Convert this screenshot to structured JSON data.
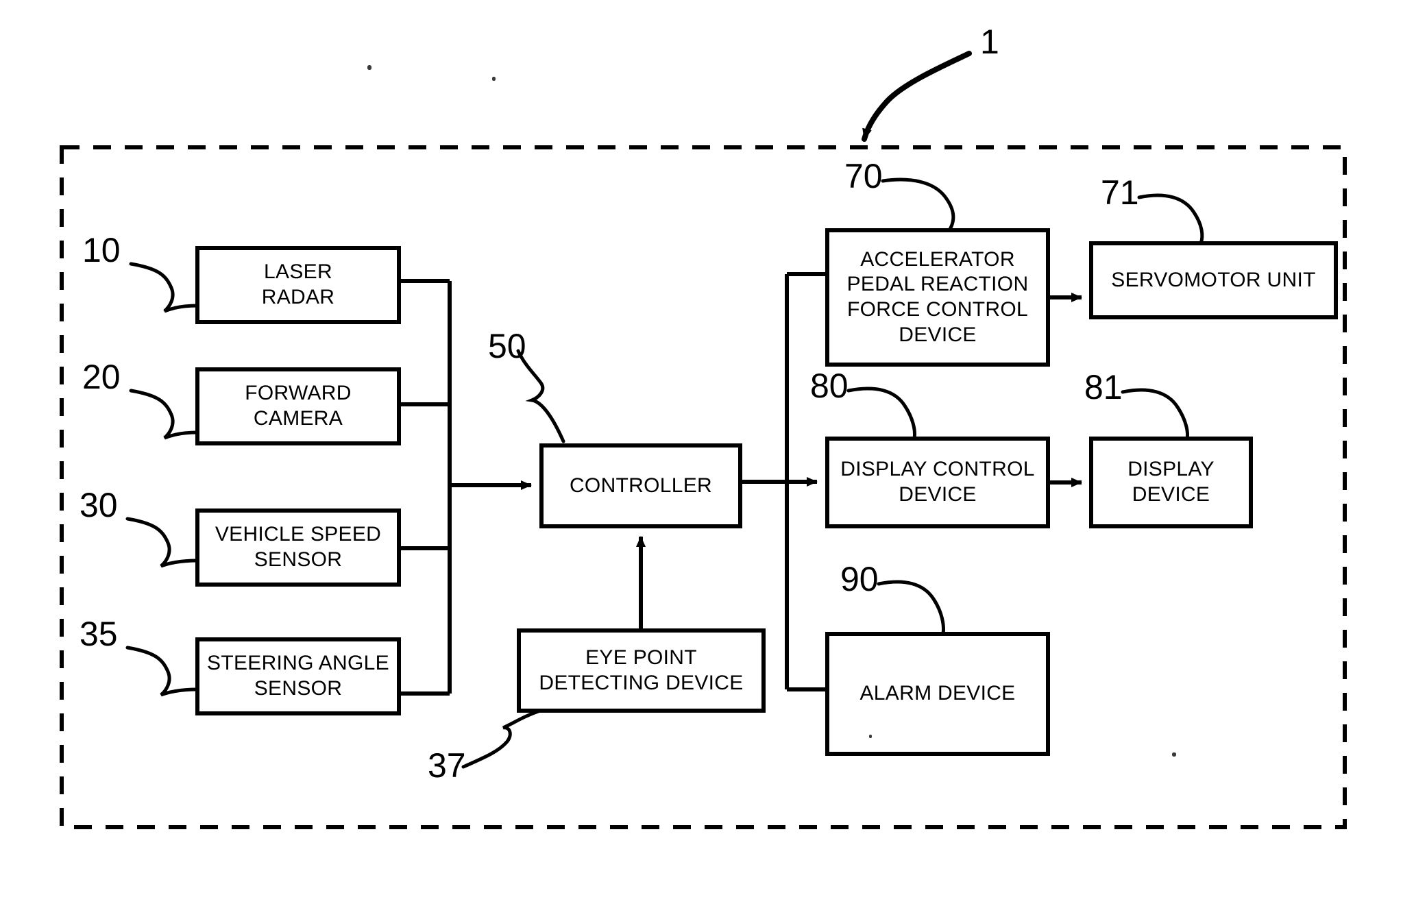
{
  "figure": {
    "system_reference": "1",
    "boundary_style": "dashed"
  },
  "blocks": [
    {
      "id": "laser_radar",
      "label": "LASER\nRADAR",
      "ref": "10"
    },
    {
      "id": "forward_camera",
      "label": "FORWARD\nCAMERA",
      "ref": "20"
    },
    {
      "id": "vehicle_speed",
      "label": "VEHICLE SPEED\nSENSOR",
      "ref": "30"
    },
    {
      "id": "steering_angle",
      "label": "STEERING ANGLE\nSENSOR",
      "ref": "35"
    },
    {
      "id": "controller",
      "label": "CONTROLLER",
      "ref": "50"
    },
    {
      "id": "eye_point",
      "label": "EYE POINT\nDETECTING DEVICE",
      "ref": "37"
    },
    {
      "id": "accel_pedal",
      "label": "ACCELERATOR\nPEDAL REACTION\nFORCE CONTROL\nDEVICE",
      "ref": "70"
    },
    {
      "id": "servomotor",
      "label": "SERVOMOTOR UNIT",
      "ref": "71"
    },
    {
      "id": "display_control",
      "label": "DISPLAY CONTROL\nDEVICE",
      "ref": "80"
    },
    {
      "id": "display_device",
      "label": "DISPLAY\nDEVICE",
      "ref": "81"
    },
    {
      "id": "alarm_device",
      "label": "ALARM DEVICE",
      "ref": "90"
    }
  ],
  "colors": {
    "stroke": "#000000",
    "background": "#ffffff"
  }
}
